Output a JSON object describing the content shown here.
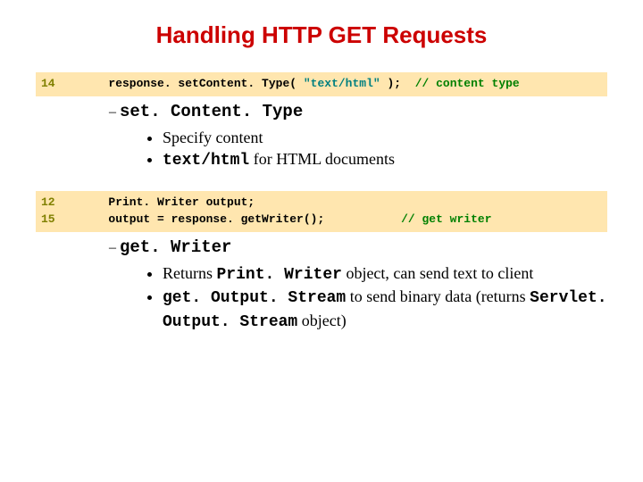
{
  "title": "Handling HTTP GET Requests",
  "block1": {
    "ln": "14",
    "pre": "   response. set",
    "pre2": "Content. Type( ",
    "str": "\"text/html\"",
    "post": " );  ",
    "comment": "// content type"
  },
  "sec1": {
    "heading": "set. Content. Type",
    "b1": "Specify content",
    "b2a": "text/html",
    "b2b": " for HTML documents"
  },
  "block2": {
    "ln": "12\n15",
    "l1": "   Print. ",
    "l1b": "Writer output;",
    "l2a": "   output = response. get",
    "l2b": "Writer();           ",
    "comment": "// get writer"
  },
  "sec2": {
    "heading": "get. Writer",
    "b1a": "Returns ",
    "b1m": "Print. Writer",
    "b1b": " object, can send text to client",
    "b2m1": "get. Output. Stream",
    "b2a": " to send binary data (returns ",
    "b2m2": "Servlet. Output. Stream",
    "b2b": " object)"
  }
}
